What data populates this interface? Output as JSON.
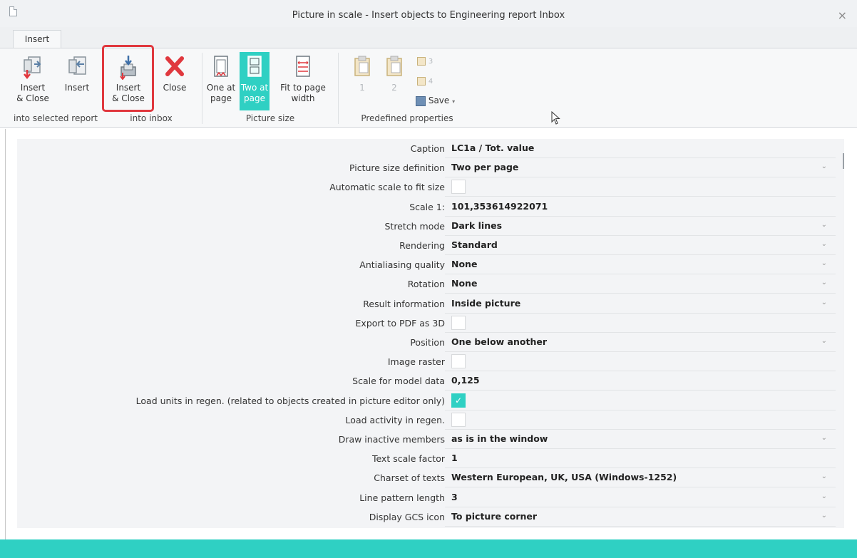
{
  "window": {
    "title": "Picture in scale - Insert objects to Engineering report Inbox",
    "close_glyph": "×"
  },
  "ribbon": {
    "tab_label": "Insert",
    "buttons": {
      "insert_close_selected": "Insert\n& Close",
      "insert_selected": "Insert",
      "insert_close_inbox": "Insert\n& Close",
      "close": "Close",
      "one_at_page": "One at\npage",
      "two_at_page": "Two at\npage",
      "fit_to_page_width": "Fit to page\nwidth",
      "predef_1": "1",
      "predef_2": "2",
      "predef_3": "3",
      "predef_4": "4",
      "save": "Save"
    },
    "groups": {
      "into_selected_report": "into selected report",
      "into_inbox": "into inbox",
      "picture_size": "Picture size",
      "predefined_properties": "Predefined properties"
    },
    "icons": {
      "insert_close_selected": "insert-close-report-icon",
      "insert_selected": "insert-report-icon",
      "insert_close_inbox": "insert-close-inbox-icon",
      "close": "close-red-x-icon",
      "one_at_page": "one-per-page-icon",
      "two_at_page": "two-per-page-icon",
      "fit_to_page_width": "fit-width-icon",
      "predef_1": "clipboard-1-icon",
      "predef_2": "clipboard-2-icon",
      "predef_3": "clipboard-small-icon",
      "predef_4": "clipboard-small-icon",
      "save": "save-icon"
    }
  },
  "properties": [
    {
      "label": "Caption",
      "value": "LC1a / Tot. value",
      "type": "text"
    },
    {
      "label": "Picture size definition",
      "value": "Two per page",
      "type": "combo"
    },
    {
      "label": "Automatic scale to fit size",
      "value": "",
      "type": "check",
      "checked": false
    },
    {
      "label": "Scale 1:",
      "value": "101,353614922071",
      "type": "text"
    },
    {
      "label": "Stretch mode",
      "value": "Dark lines",
      "type": "combo"
    },
    {
      "label": "Rendering",
      "value": "Standard",
      "type": "combo"
    },
    {
      "label": "Antialiasing quality",
      "value": "None",
      "type": "combo"
    },
    {
      "label": "Rotation",
      "value": "None",
      "type": "combo"
    },
    {
      "label": "Result information",
      "value": "Inside picture",
      "type": "combo"
    },
    {
      "label": "Export to PDF as 3D",
      "value": "",
      "type": "check",
      "checked": false
    },
    {
      "label": "Position",
      "value": "One below another",
      "type": "combo"
    },
    {
      "label": "Image raster",
      "value": "",
      "type": "check",
      "checked": false
    },
    {
      "label": "Scale for model data",
      "value": "0,125",
      "type": "text"
    },
    {
      "label": "Load units in regen. (related to objects created in picture editor only)",
      "value": "",
      "type": "check",
      "checked": true
    },
    {
      "label": "Load activity in regen.",
      "value": "",
      "type": "check",
      "checked": false
    },
    {
      "label": "Draw inactive members",
      "value": "as is in the window",
      "type": "combo"
    },
    {
      "label": "Text scale factor",
      "value": "1",
      "type": "text"
    },
    {
      "label": "Charset of texts",
      "value": "Western European, UK, USA (Windows-1252)",
      "type": "combo"
    },
    {
      "label": "Line pattern length",
      "value": "3",
      "type": "combo"
    },
    {
      "label": "Display GCS icon",
      "value": "To picture corner",
      "type": "combo"
    }
  ],
  "colors": {
    "accent": "#2fd0c3",
    "highlight_border": "#e0383e",
    "close_red": "#e0383e"
  }
}
